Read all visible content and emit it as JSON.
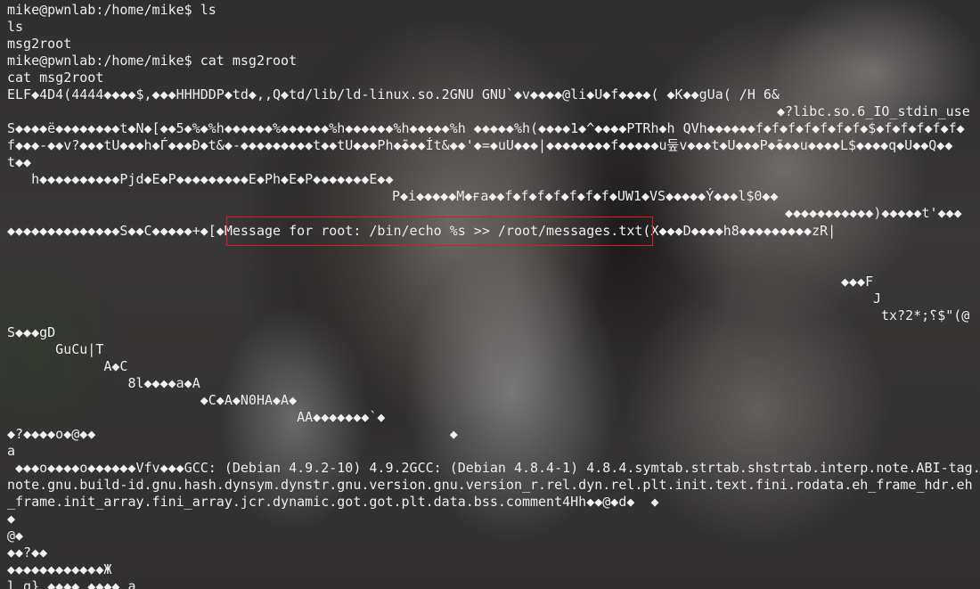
{
  "terminal": {
    "lines": [
      "mike@pwnlab:/home/mike$ ls",
      "ls",
      "msg2root",
      "mike@pwnlab:/home/mike$ cat msg2root",
      "cat msg2root",
      "ELF◆4D4(4444◆◆◆◆$,◆◆◆HHHDDP◆td◆,,Q◆td/lib/ld-linux.so.2GNU GNU`◆v◆◆◆◆@li◆U◆f◆◆◆◆( ◆K◆◆gUa( /H 6&",
      "◆?libc.so.6_IO_stdin_use",
      "S◆◆◆◆ë◆◆◆◆◆◆◆◆t◆N◆[◆◆5◆%◆%h◆◆◆◆◆◆%◆◆◆◆◆◆%h◆◆◆◆◆◆%h◆◆◆◆◆%h ◆◆◆◆◆%h(◆◆◆◆1◆^◆◆◆◆PTRh◆h QVh◆◆◆◆◆◆f◆f◆f◆f◆f◆f◆f◆$◆f◆f◆f◆f◆f◆",
      "f◆◆◆-◆◆v?◆◆◆tU◆◆◆h◆Ѓ◆◆◆Ð◆t&◆-◆◆◆◆◆◆◆◆◆t◆◆tU◆◆◆Ph◆̃◆◆◆Ít&◆◆'◆=◆uU◆◆◆|◆◆◆◆◆◆◆◆f◆◆◆◆◆u둪v◆◆◆t◆U◆◆◆P◆̃◆◆◆u◆◆◆◆L$◆◆◆◆q◆U◆◆Q◆◆",
      "t◆◆",
      "   h◆◆◆◆◆◆◆◆◆◆Pjd◆E◆P◆◆◆◆◆◆◆◆◆E◆Ph◆E◆P◆◆◆◆◆◆◆E◆◆",
      "P◆i◆◆◆◆◆M◆ғa◆◆f◆f◆f◆f◆f◆f◆f◆UW1◆VS◆◆◆◆◆Ý◆◆◆l$0◆◆",
      "◆◆◆◆◆◆◆◆◆◆◆)◆◆◆◆◆t'◆◆◆",
      "◆◆◆◆◆◆◆◆◆◆◆◆◆◆S◆◆C◆◆◆◆◆+◆[◆Message for root: /bin/echo %s >> /root/messages.txt(X◆◆◆D◆◆◆◆h8◆◆◆◆◆◆◆◆◆zR|",
      "",
      "",
      "◆◆◆F",
      "J",
      "tx?؟;*2$\"(@",
      "S◆◆◆gD",
      "      GuCu|T",
      "            A◆C",
      "               8l◆◆◆◆a◆A",
      "                        ◆C◆A◆N0HA◆A◆",
      "                                    AA◆◆◆◆◆◆◆`◆",
      "◆?◆◆◆◆o◆@◆◆                                            ◆",
      "a",
      " ◆◆◆o◆◆◆◆o◆◆◆◆◆◆Vfv◆◆◆GCC: (Debian 4.9.2-10) 4.9.2GCC: (Debian 4.8.4-1) 4.8.4.symtab.strtab.shstrtab.interp.note.ABI-tag.",
      "note.gnu.build-id.gnu.hash.dynsym.dynstr.gnu.version.gnu.version_r.rel.dyn.rel.plt.init.text.fini.rodata.eh_frame_hdr.eh",
      "_frame.init_array.fini_array.jcr.dynamic.got.got.plt.data.bss.comment4Hh◆◆@◆d◆  ◆",
      "◆",
      "@◆",
      "◆◆?◆◆",
      "◆◆◆◆◆◆◆◆◆◆◆◆Ж",
      "l g} ◆◆◆◆ ◆◆◆◆ a"
    ]
  },
  "highlight": {
    "color": "#e01b1b",
    "text": "Message for root: /bin/echo %s >> /root/messages.txt"
  }
}
